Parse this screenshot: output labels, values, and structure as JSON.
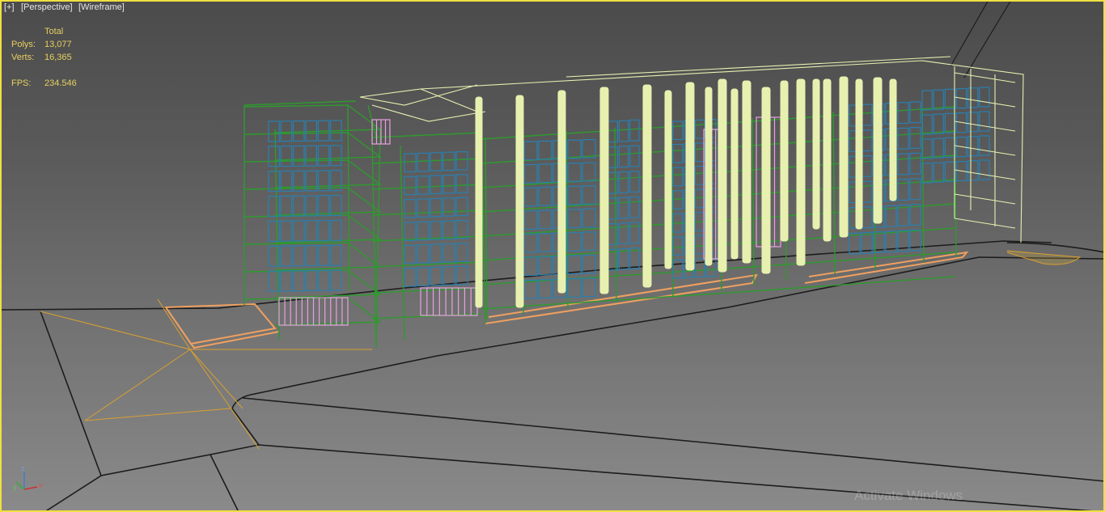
{
  "viewport": {
    "labels": {
      "plus": "[+]",
      "perspective": "[Perspective]",
      "shading": "[Wireframe]"
    },
    "stats": {
      "header": "Total",
      "polys_label": "Polys:",
      "polys_value": "13,077",
      "verts_label": "Verts:",
      "verts_value": "16,365",
      "fps_label": "FPS:",
      "fps_value": "234.546"
    },
    "gizmo": {
      "x": "x",
      "y": "y",
      "z": "z"
    },
    "watermark": "Activate Windows"
  },
  "colors": {
    "border_active": "#f0e040",
    "stats_text": "#e8d060",
    "label_text": "#e6e6e6",
    "wire_green": "#2e9a2e",
    "wire_blue": "#2a7fb0",
    "wire_pale": "#e8f0b0",
    "wire_pink": "#e8a0e0",
    "wire_orange": "#f0a060",
    "wire_yellow": "#d8b040",
    "ground_line": "#1c1c1c"
  }
}
